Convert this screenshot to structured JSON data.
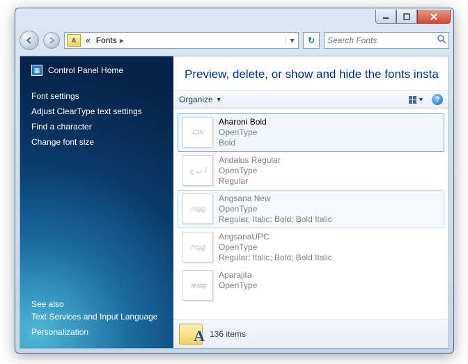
{
  "window_controls": {
    "min_glyph": "–",
    "close_glyph": "×"
  },
  "breadcrumb": {
    "prefix": "«",
    "item": "Fonts",
    "sep": "▸",
    "dropdown_glyph": "▾",
    "refresh_glyph": "↻"
  },
  "search": {
    "placeholder": "Search Fonts",
    "icon_glyph": "🔍"
  },
  "sidebar": {
    "home": "Control Panel Home",
    "links": [
      "Font settings",
      "Adjust ClearType text settings",
      "Find a character",
      "Change font size"
    ],
    "see_also_label": "See also",
    "see_also_links": [
      "Text Services and Input Language",
      "Personalization"
    ]
  },
  "page_title": "Preview, delete, or show and hide the fonts insta",
  "toolbar": {
    "organize_label": "Organize",
    "organize_caret": "▼",
    "view_caret": "▼",
    "help_glyph": "?"
  },
  "fonts": [
    {
      "name": "Aharoni Bold",
      "type": "OpenType",
      "styles": "Bold",
      "preview": "אבג",
      "selected": true,
      "dim": false
    },
    {
      "name": "Andalus Regular",
      "type": "OpenType",
      "styles": "Regular",
      "preview": "ا ب ج",
      "selected": false,
      "dim": true
    },
    {
      "name": "Angsana New",
      "type": "OpenType",
      "styles": "Regular; Italic; Bold; Bold Italic",
      "preview": "กญฎ",
      "selected": false,
      "dim": true,
      "hover": true
    },
    {
      "name": "AngsanaUPC",
      "type": "OpenType",
      "styles": "Regular; Italic; Bold; Bold Italic",
      "preview": "กญฎ",
      "selected": false,
      "dim": true
    },
    {
      "name": "Aparajita",
      "type": "OpenType",
      "styles": "",
      "preview": "अआइ",
      "selected": false,
      "dim": true
    }
  ],
  "status": {
    "count_text": "136 items"
  }
}
